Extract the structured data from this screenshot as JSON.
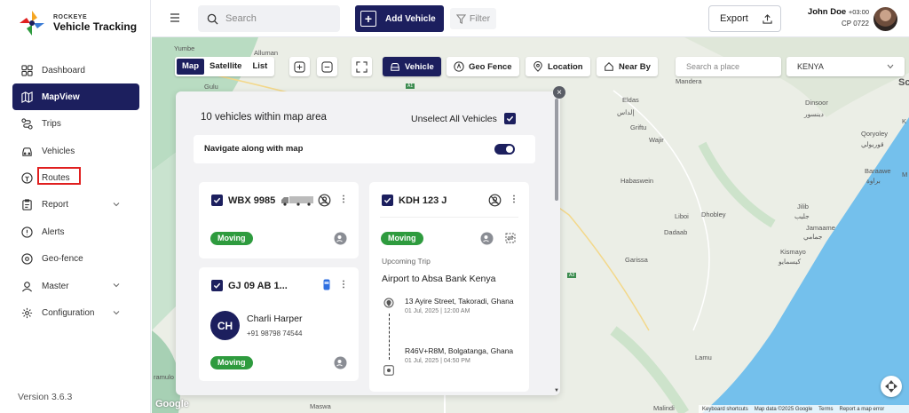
{
  "brand": {
    "small": "ROCKEYE",
    "name": "Vehicle Tracking"
  },
  "sidebar": {
    "items": [
      {
        "label": "Dashboard",
        "icon": "grid-icon"
      },
      {
        "label": "MapView",
        "icon": "map-icon",
        "active": true
      },
      {
        "label": "Trips",
        "icon": "route-icon"
      },
      {
        "label": "Vehicles",
        "icon": "car-icon"
      },
      {
        "label": "Routes",
        "icon": "routes-icon"
      },
      {
        "label": "Report",
        "icon": "report-icon",
        "expandable": true
      },
      {
        "label": "Alerts",
        "icon": "alert-icon"
      },
      {
        "label": "Geo-fence",
        "icon": "pin-icon"
      },
      {
        "label": "Master",
        "icon": "master-icon",
        "expandable": true
      },
      {
        "label": "Configuration",
        "icon": "gear-icon",
        "expandable": true
      }
    ],
    "version": "Version 3.6.3"
  },
  "topbar": {
    "search_placeholder": "Search",
    "add_vehicle": "Add Vehicle",
    "filter": "Filter",
    "export": "Export",
    "user_name": "John Doe",
    "user_tz": "+03:00",
    "user_code": "CP 0722"
  },
  "map_toolbar": {
    "views": [
      "Map",
      "Satellite",
      "List"
    ],
    "active_view": "Map",
    "vehicle": "Vehicle",
    "geo_fence": "Geo Fence",
    "location": "Location",
    "near_by": "Near By",
    "place_placeholder": "Search a place",
    "country": "KENYA"
  },
  "map_places": {
    "yumbe": "Yumbe",
    "alluman": "Alluman",
    "gulu": "Gulu",
    "mandera": "Mandera",
    "eldas": "Eldas",
    "eldas_ar": "إلداس",
    "dinsoor": "Dinsoor",
    "dinsoor_ar": "دينسور",
    "griftu": "Griftu",
    "wajir": "Wajir",
    "qoryoley": "Qoryoley",
    "qoryoley_ar": "قوريولي",
    "habaswein": "Habaswein",
    "baraawe": "Baraawe",
    "baraawe_ar": "براوة",
    "jilib": "Jilib",
    "jilib_ar": "جليب",
    "liboi": "Liboi",
    "dhobley": "Dhobley",
    "jamaame": "Jamaame",
    "jamaame_ar": "جمامي",
    "dadaab": "Dadaab",
    "kismayo": "Kismayo",
    "kismayo_ar": "كيسمايو",
    "garissa": "Garissa",
    "lamu": "Lamu",
    "malindi": "Malindi",
    "maswa": "Maswa",
    "ramulo": "ramulo",
    "edge_s": "Sc",
    "edge_k": "K",
    "edge_m": "M",
    "road_a1": "A1",
    "road_a3": "A3"
  },
  "panel": {
    "count_text": "10 vehicles within map area",
    "unselect": "Unselect All Vehicles",
    "navigate": "Navigate along with map",
    "cards": [
      {
        "plate": "WBX 9985",
        "status": "Moving"
      },
      {
        "plate": "KDH 123 J",
        "status": "Moving",
        "trip_label": "Upcoming Trip",
        "trip_name": "Airport to Absa Bank Kenya",
        "stops": [
          {
            "address": "13 Ayire Street, Takoradi, Ghana",
            "time": "01 Jul, 2025 | 12:00 AM"
          },
          {
            "address": "R46V+R8M, Bolgatanga, Ghana",
            "time": "01 Jul, 2025 | 04:50 PM"
          }
        ]
      },
      {
        "plate": "GJ 09 AB 1...",
        "status": "Moving",
        "driver_initials": "CH",
        "driver_name": "Charli Harper",
        "driver_phone": "+91 98798 74544"
      }
    ]
  },
  "attribution": [
    "Keyboard shortcuts",
    "Map data ©2025 Google",
    "Terms",
    "Report a map error"
  ],
  "google_logo": "Google",
  "colors": {
    "primary": "#1c1f5e",
    "moving": "#2e9b3e",
    "highlight": "#e02020",
    "sea": "#74c0ec"
  }
}
